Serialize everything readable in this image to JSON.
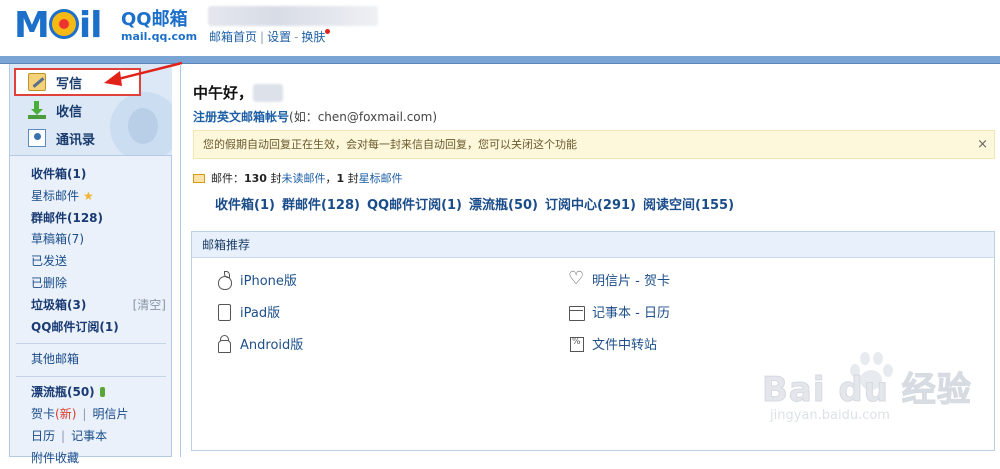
{
  "header": {
    "logo_title": "QQ邮箱",
    "logo_domain": "mail.qq.com",
    "logo_word": "MoIl",
    "links": [
      "邮箱首页",
      "设置",
      "换肤"
    ],
    "sep_pipe": "|",
    "sep_dash": "-"
  },
  "sidebar": {
    "actions": [
      "写信",
      "收信",
      "通讯录"
    ],
    "folders": {
      "inbox": "收件箱(1)",
      "starred": "星标邮件",
      "group": "群邮件(128)",
      "drafts": "草稿箱(7)",
      "sent": "已发送",
      "deleted": "已删除",
      "spam": "垃圾箱(3)",
      "spam_clear": "[清空]",
      "qq_sub": "QQ邮件订阅(1)",
      "other": "其他邮箱",
      "bottle": "漂流瓶(50)",
      "card": "贺卡",
      "card_new": "(新)",
      "postcard": "明信片",
      "calendar": "日历",
      "notes": "记事本",
      "attachments": "附件收藏"
    }
  },
  "main": {
    "greeting": "中午好，",
    "register_link": "注册英文邮箱帐号",
    "register_hint": "(如：chen@foxmail.com)",
    "notice": "您的假期自动回复正在生效，会对每一封来信自动回复，您可以关闭这个功能",
    "notice_close": "×",
    "summary": {
      "prefix": "邮件：",
      "count1": "130",
      "mid1": " 封",
      "link1": "未读邮件",
      "mid2": "，",
      "count2": "1",
      "mid3": " 封",
      "link2": "星标邮件"
    },
    "quick_links": [
      "收件箱(1)",
      "群邮件(128)",
      "QQ邮件订阅(1)",
      "漂流瓶(50)",
      "订阅中心(291)",
      "阅读空间(155)"
    ],
    "recommend": {
      "title": "邮箱推荐",
      "left": [
        "iPhone版",
        "iPad版",
        "Android版"
      ],
      "right": [
        "明信片 - 贺卡",
        "记事本 - 日历",
        "文件中转站"
      ]
    }
  },
  "watermark": {
    "main": "Bai du 经验",
    "sub": "jingyan.baidu.com"
  },
  "colors": {
    "brand_blue": "#1d70c9",
    "highlight_red": "#e0413b",
    "notice_bg": "#fdf7dc"
  }
}
